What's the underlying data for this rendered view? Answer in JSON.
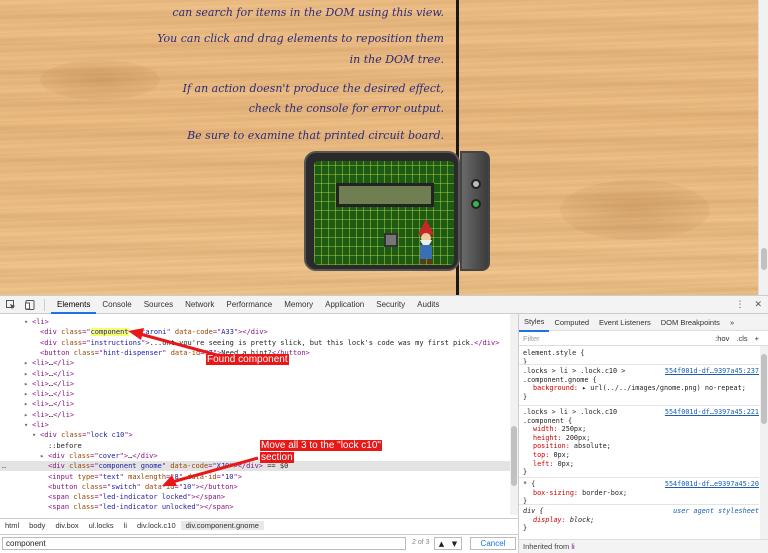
{
  "page": {
    "hint_lines": [
      "can search for items in the DOM using this view.",
      "You can click and drag elements to reposition them",
      "in the DOM tree.",
      "If an action doesn't produce the desired effect,",
      "check the console for error output.",
      "Be sure to examine that printed circuit board."
    ]
  },
  "devtools": {
    "tabs": [
      "Elements",
      "Console",
      "Sources",
      "Network",
      "Performance",
      "Memory",
      "Application",
      "Security",
      "Audits"
    ],
    "active_tab": "Elements",
    "more_icon": "»",
    "menu_icon": "⋮",
    "close_icon": "✕"
  },
  "elements": {
    "lines": [
      {
        "indent": 3,
        "tri": "▾",
        "html": "li"
      },
      {
        "indent": 4,
        "parts": [
          [
            "tag",
            "<div "
          ],
          [
            "an",
            "class"
          ],
          [
            "tag",
            "=\""
          ],
          [
            "hl",
            "component"
          ],
          [
            "av",
            " macaroni"
          ],
          [
            "tag",
            "\" "
          ],
          [
            "an",
            "data-code"
          ],
          [
            "tag",
            "=\""
          ],
          [
            "av",
            "A33"
          ],
          [
            "tag",
            "\"></div>"
          ]
        ]
      },
      {
        "indent": 4,
        "parts": [
          [
            "tag",
            "<div "
          ],
          [
            "an",
            "class"
          ],
          [
            "tag",
            "=\""
          ],
          [
            "av",
            "instructions"
          ],
          [
            "tag",
            "\">"
          ],
          [
            "txt",
            "...ont you're seeing is pretty slick, but this lock's code was my first pick."
          ],
          [
            "tag",
            "</div>"
          ]
        ]
      },
      {
        "indent": 4,
        "parts": [
          [
            "tag",
            "<button "
          ],
          [
            "an",
            "class"
          ],
          [
            "tag",
            "=\""
          ],
          [
            "av",
            "hint-dispenser"
          ],
          [
            "tag",
            "\" "
          ],
          [
            "an",
            "data-id"
          ],
          [
            "tag",
            "=\""
          ],
          [
            "av",
            "7"
          ],
          [
            "tag",
            "\">"
          ],
          [
            "txt",
            "Need a hint?"
          ],
          [
            "tag",
            "</button>"
          ]
        ]
      },
      {
        "indent": 3,
        "tri": "▸",
        "html": "li...li"
      },
      {
        "indent": 3,
        "tri": "▸",
        "html": "li...li"
      },
      {
        "indent": 3,
        "tri": "▸",
        "html": "li...li"
      },
      {
        "indent": 3,
        "tri": "▸",
        "html": "li...li"
      },
      {
        "indent": 3,
        "tri": "▸",
        "html": "li...li"
      },
      {
        "indent": 3,
        "tri": "▸",
        "html": "li...li"
      },
      {
        "indent": 3,
        "tri": "▾",
        "html": "li"
      },
      {
        "indent": 4,
        "tri": "▾",
        "parts": [
          [
            "tag",
            "<div "
          ],
          [
            "an",
            "class"
          ],
          [
            "tag",
            "=\""
          ],
          [
            "av",
            "lock c10"
          ],
          [
            "tag",
            "\">"
          ]
        ]
      },
      {
        "indent": 5,
        "parts": [
          [
            "txt",
            "::before"
          ]
        ]
      },
      {
        "indent": 5,
        "tri": "▸",
        "parts": [
          [
            "tag",
            "<div "
          ],
          [
            "an",
            "class"
          ],
          [
            "tag",
            "=\""
          ],
          [
            "av",
            "cover"
          ],
          [
            "tag",
            "\">"
          ],
          [
            "txt",
            "…"
          ],
          [
            "tag",
            "</div>"
          ]
        ]
      },
      {
        "indent": 5,
        "sel": true,
        "parts": [
          [
            "tag",
            "<div "
          ],
          [
            "an",
            "class"
          ],
          [
            "tag",
            "=\""
          ],
          [
            "av",
            "component gnome"
          ],
          [
            "tag",
            "\" "
          ],
          [
            "an",
            "data-code"
          ],
          [
            "tag",
            "=\""
          ],
          [
            "av",
            "XJ0"
          ],
          [
            "tag",
            "\"></div>"
          ],
          [
            "txt",
            " == $0"
          ]
        ]
      },
      {
        "indent": 5,
        "parts": [
          [
            "tag",
            "<input "
          ],
          [
            "an",
            "type"
          ],
          [
            "tag",
            "=\""
          ],
          [
            "av",
            "text"
          ],
          [
            "tag",
            "\" "
          ],
          [
            "an",
            "maxlength"
          ],
          [
            "tag",
            "=\""
          ],
          [
            "av",
            "8"
          ],
          [
            "tag",
            "\" "
          ],
          [
            "an",
            "data-id"
          ],
          [
            "tag",
            "=\""
          ],
          [
            "av",
            "10"
          ],
          [
            "tag",
            "\">"
          ]
        ]
      },
      {
        "indent": 5,
        "parts": [
          [
            "tag",
            "<button "
          ],
          [
            "an",
            "class"
          ],
          [
            "tag",
            "=\""
          ],
          [
            "av",
            "switch"
          ],
          [
            "tag",
            "\" "
          ],
          [
            "an",
            "data-id"
          ],
          [
            "tag",
            "=\""
          ],
          [
            "av",
            "10"
          ],
          [
            "tag",
            "\"></button>"
          ]
        ]
      },
      {
        "indent": 5,
        "parts": [
          [
            "tag",
            "<span "
          ],
          [
            "an",
            "class"
          ],
          [
            "tag",
            "=\""
          ],
          [
            "av",
            "led-indicator locked"
          ],
          [
            "tag",
            "\"></span>"
          ]
        ]
      },
      {
        "indent": 5,
        "parts": [
          [
            "tag",
            "<span "
          ],
          [
            "an",
            "class"
          ],
          [
            "tag",
            "=\""
          ],
          [
            "av",
            "led-indicator unlocked"
          ],
          [
            "tag",
            "\"></span>"
          ]
        ]
      }
    ],
    "annotation_found": "Found component",
    "annotation_move_1": "Move all 3 to the \"lock c10\"",
    "annotation_move_2": "section",
    "selected_suffix": "== $0"
  },
  "breadcrumbs": [
    "html",
    "body",
    "div.box",
    "ul.locks",
    "li",
    "div.lock.c10",
    "div.component.gnome"
  ],
  "search": {
    "value": "component",
    "count": "2 of 3",
    "up": "▲",
    "down": "▼",
    "cancel_label": "Cancel"
  },
  "styles": {
    "tabs": [
      "Styles",
      "Computed",
      "Event Listeners",
      "DOM Breakpoints",
      "»"
    ],
    "active_tab": "Styles",
    "filter_placeholder": "Filter",
    "hov": ":hov",
    "cls": ".cls",
    "plus": "+",
    "rules": [
      {
        "selector": "element.style {",
        "source": "",
        "props": [],
        "close": "}"
      },
      {
        "selector": ".locks > li > .lock.c10 >",
        "selector2": ".component.gnome {",
        "source": "554f001d-df…9397a45:237",
        "props": [
          [
            "background",
            "▸ url(../../images/gnome.png) no-repeat;"
          ]
        ],
        "close": "}"
      },
      {
        "selector": ".locks > li > .lock.c10",
        "selector2": ".component {",
        "source": "554f001d-df…9397a45:221",
        "props": [
          [
            "width",
            "250px;"
          ],
          [
            "height",
            "200px;"
          ],
          [
            "position",
            "absolute;"
          ],
          [
            "top",
            "0px;"
          ],
          [
            "left",
            "0px;"
          ]
        ],
        "close": "}"
      },
      {
        "selector": "* {",
        "source": "554f001d-df…e9397a45:20",
        "props": [
          [
            "box-sizing",
            "border-box;"
          ]
        ],
        "close": "}"
      },
      {
        "selector": "div {",
        "source": "user agent stylesheet",
        "props": [
          [
            "display",
            "block;"
          ]
        ],
        "close": "}"
      }
    ],
    "inherited": "Inherited from ",
    "inherited_from": "li"
  },
  "colors": {
    "annotation_red": "#e81818",
    "search_highlight": "#f5ff66",
    "accent": "#1a73e8"
  }
}
